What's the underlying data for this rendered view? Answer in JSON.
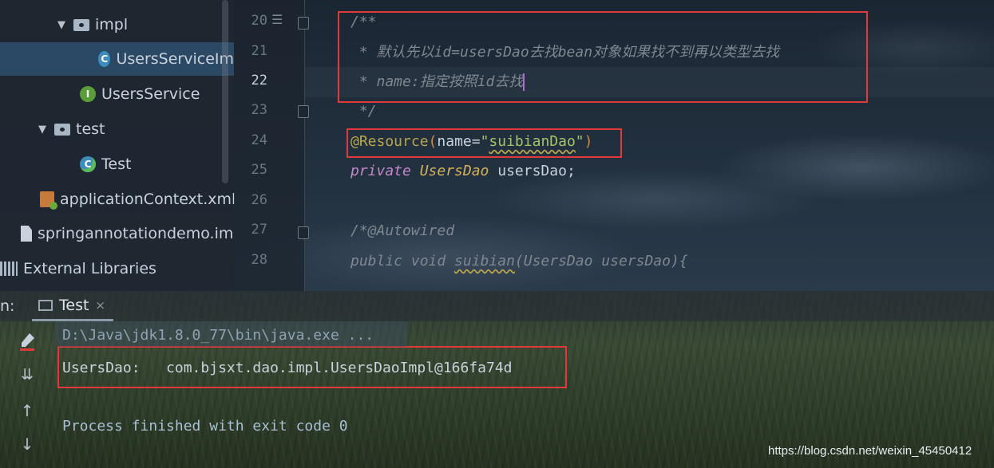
{
  "project_tree": {
    "items": [
      {
        "label": "impl",
        "type": "folder",
        "expanded": true
      },
      {
        "label": "UsersServiceIm",
        "type": "class-icon"
      },
      {
        "label": "UsersService",
        "type": "interface-icon"
      },
      {
        "label": "test",
        "type": "folder",
        "expanded": true
      },
      {
        "label": "Test",
        "type": "test-class-icon"
      },
      {
        "label": "applicationContext.xml",
        "type": "xml-file-icon"
      },
      {
        "label": "springannotationdemo.im",
        "type": "iml-file-icon"
      },
      {
        "label": "External Libraries",
        "type": "library-icon"
      }
    ]
  },
  "editor": {
    "line_numbers": [
      "20",
      "21",
      "22",
      "23",
      "24",
      "25",
      "26",
      "27",
      "28"
    ],
    "current_line": "22",
    "lines": {
      "l20": "/**",
      "l21": " * 默认先以id=usersDao去找bean对象如果找不到再以类型去找",
      "l22": " * name:指定按照id去找",
      "l23": " */",
      "l24_anno": "@Resource",
      "l24_open": "(",
      "l24_name": "name=",
      "l24_str_q1": "\"",
      "l24_str": "suibianDao",
      "l24_str_q2": "\"",
      "l24_close": ")",
      "l25_kw": "private",
      "l25_type": "UsersDao",
      "l25_ident": " usersDao;",
      "l27": "/*@Autowired",
      "l28_a": "public void ",
      "l28_b": "suibian",
      "l28_c": "(UsersDao usersDao){"
    }
  },
  "run": {
    "label": "n:",
    "tab_label": "Test",
    "tab_close": "×",
    "console": {
      "path": "D:\\Java\\jdk1.8.0_77\\bin\\java.exe ...",
      "output": "UsersDao:   com.bjsxt.dao.impl.UsersDaoImpl@166fa74d",
      "finish": "Process finished with exit code 0"
    }
  },
  "watermark": "https://blog.csdn.net/weixin_45450412",
  "colors": {
    "highlight_box": "#e23a3a",
    "annotation": "#b8a64e",
    "keyword": "#c487c9",
    "string": "#a7c26a",
    "comment": "#7f8790"
  }
}
